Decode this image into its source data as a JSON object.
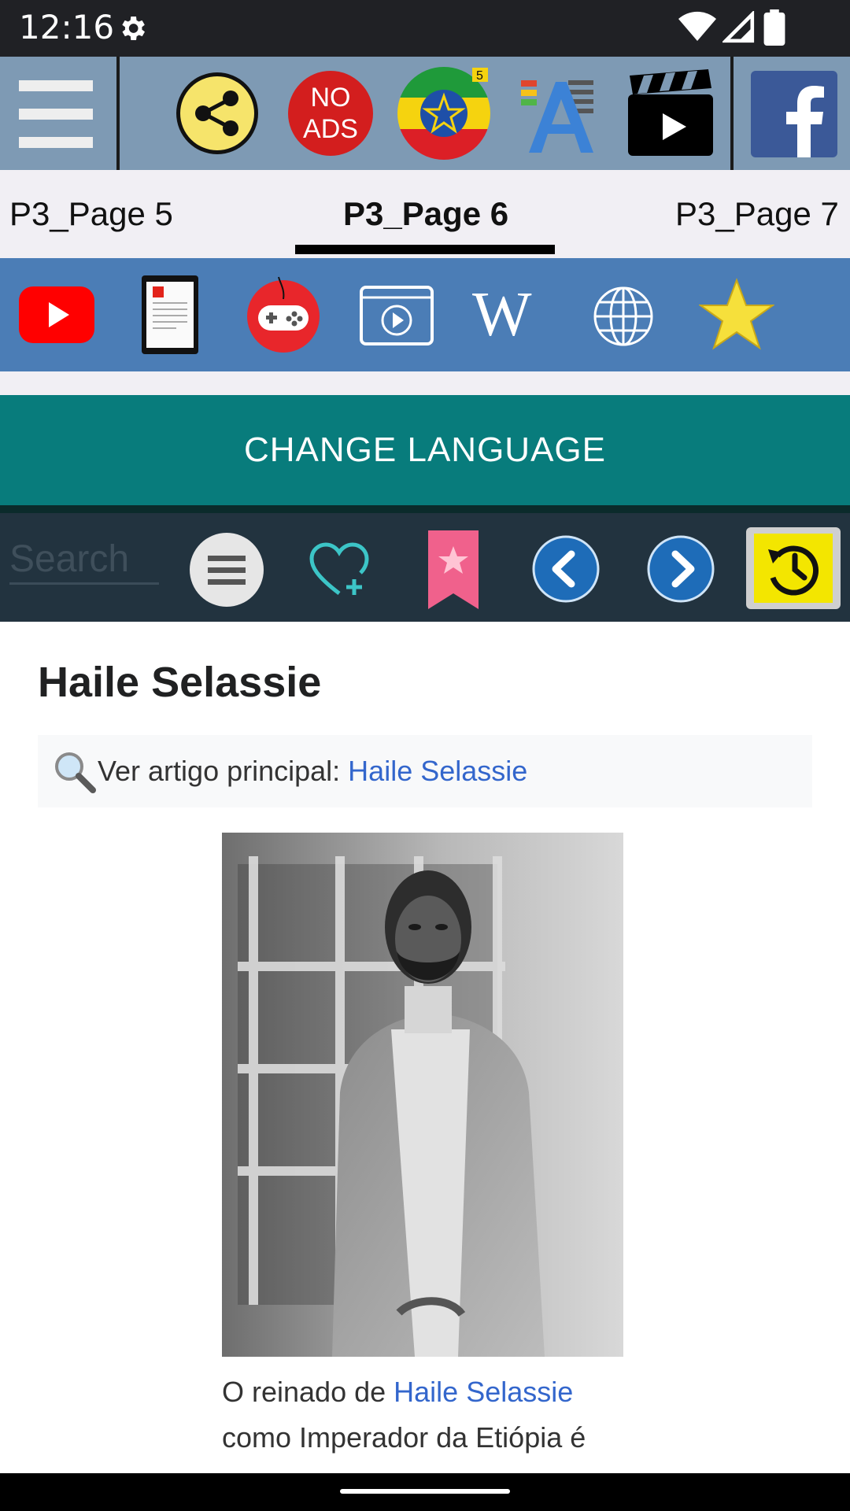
{
  "status_bar": {
    "time": "12:16"
  },
  "toolbar": {
    "icons": [
      "menu-icon",
      "share-icon",
      "no-ads-icon",
      "ethiopia-flag-icon",
      "font-size-icon",
      "video-clapper-icon",
      "facebook-icon"
    ],
    "no_ads_line1": "NO",
    "no_ads_line2": "ADS",
    "flag_badge": "5"
  },
  "tabs": [
    {
      "label": "P3_Page 5",
      "active": false
    },
    {
      "label": "P3_Page 6",
      "active": true
    },
    {
      "label": "P3_Page 7",
      "active": false
    }
  ],
  "icon_bar": {
    "icons": [
      "youtube-icon",
      "ebook-icon",
      "gamepad-icon",
      "video-player-icon",
      "wikipedia-icon",
      "globe-icon",
      "star-icon"
    ],
    "wikipedia_letter": "W"
  },
  "change_language_label": "CHANGE LANGUAGE",
  "search": {
    "placeholder": "Search",
    "icons": [
      "list-menu-icon",
      "heart-add-icon",
      "bookmark-icon",
      "back-arrow-icon",
      "forward-arrow-icon",
      "history-icon"
    ]
  },
  "article": {
    "title": "Haile Selassie",
    "hatnote_prefix": "Ver artigo principal: ",
    "hatnote_link": "Haile Selassie",
    "caption_prefix": "O reinado de ",
    "caption_link": "Haile Selassie",
    "caption_line2": "como Imperador da Etiópia é"
  },
  "colors": {
    "toolbar_bg": "#7e9ab4",
    "icon_bar_bg": "#4b7db6",
    "language_button_bg": "#087c7c",
    "search_bar_bg": "#22333f",
    "link": "#3366cc"
  }
}
